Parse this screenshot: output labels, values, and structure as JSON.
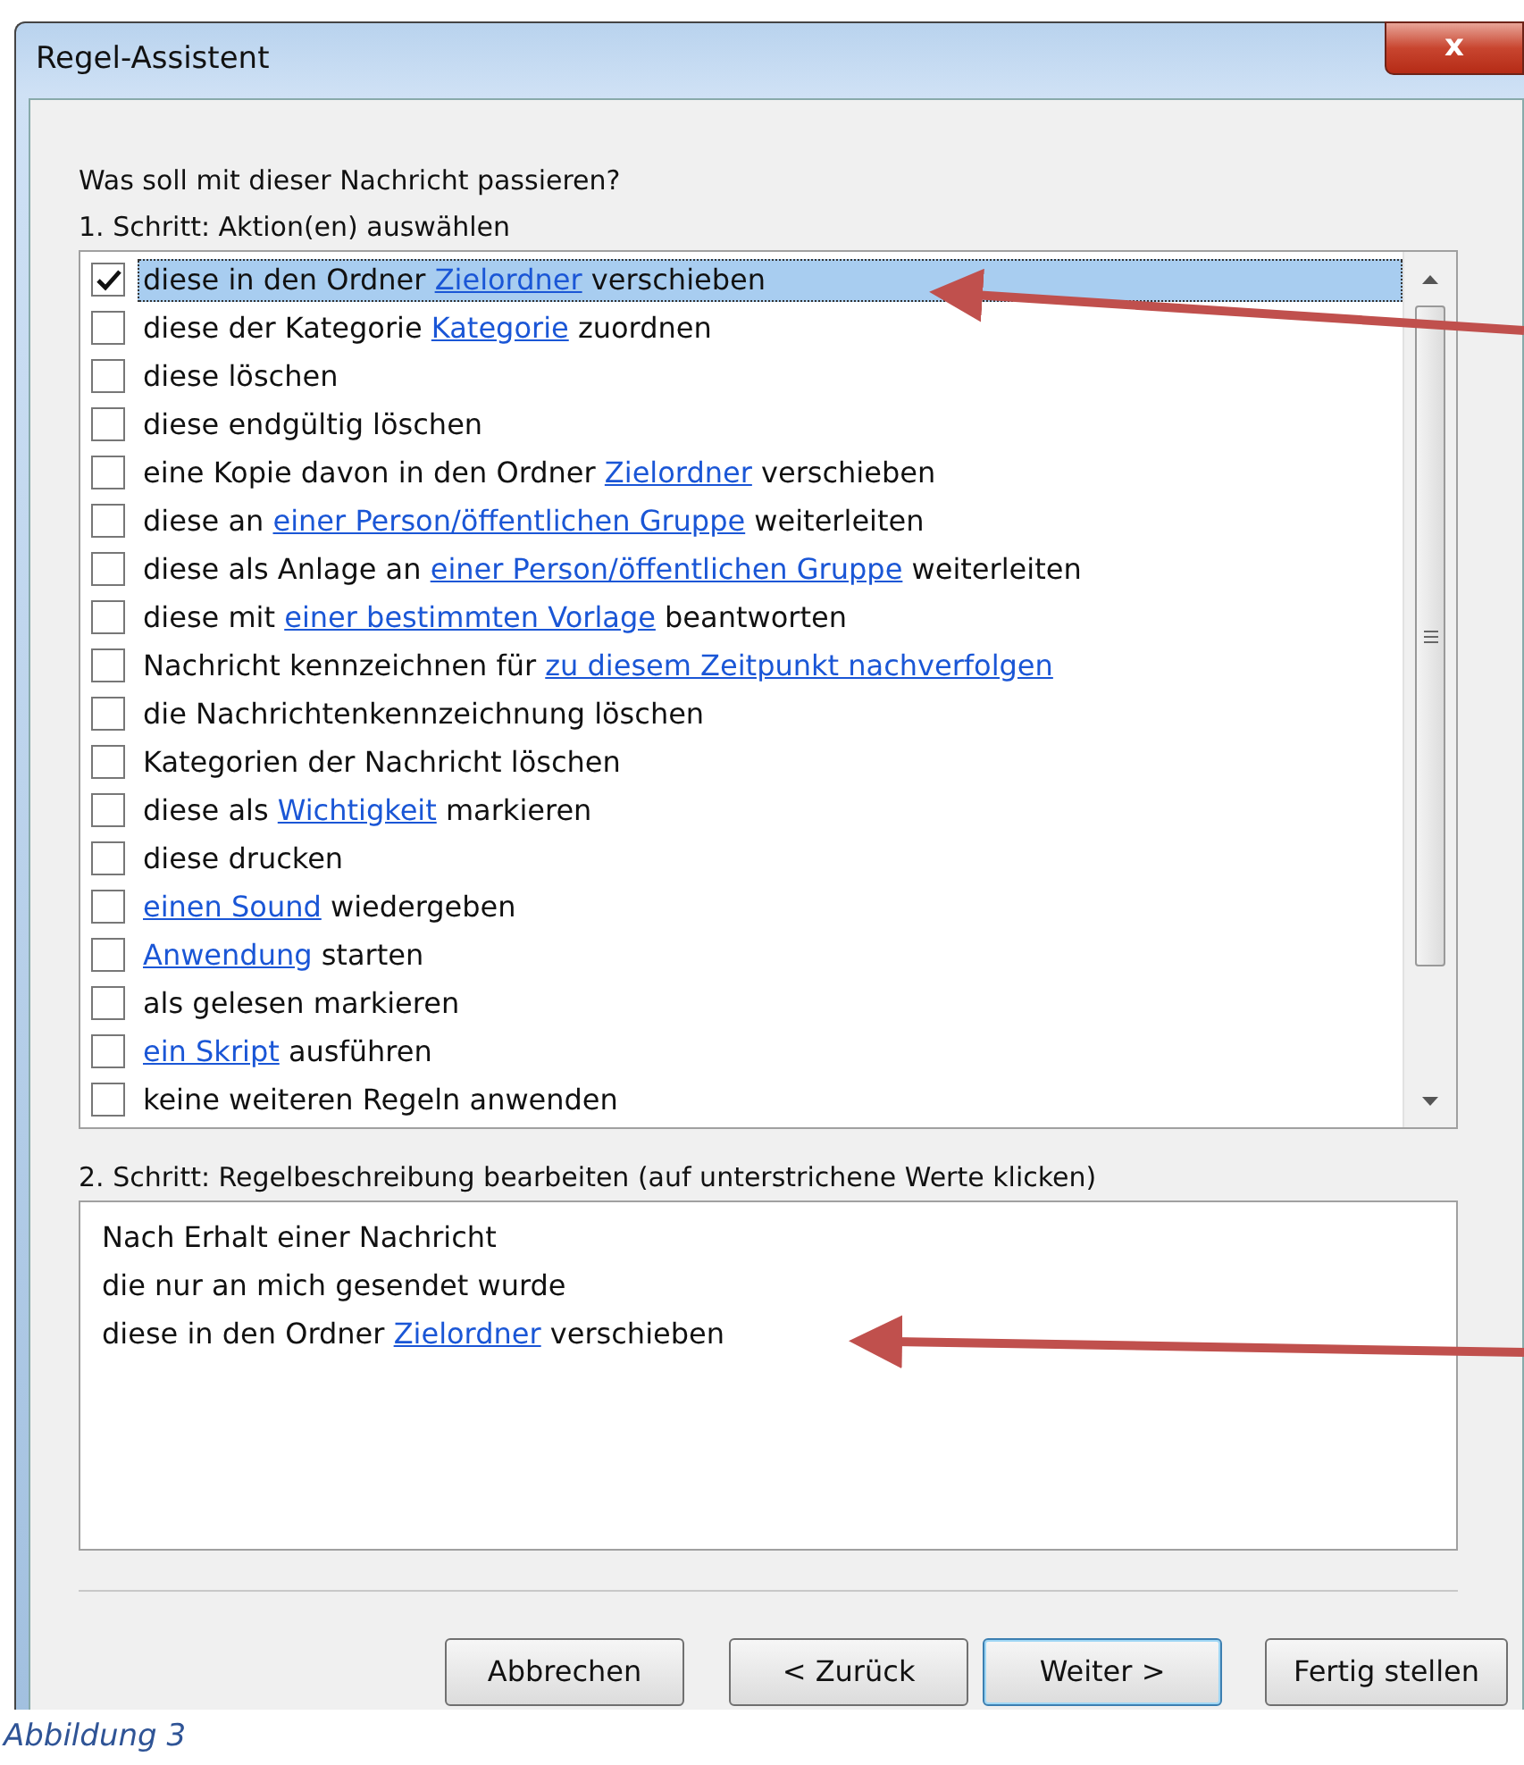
{
  "window": {
    "title": "Regel-Assistent",
    "close": "x"
  },
  "question": "Was soll mit dieser Nachricht passieren?",
  "step1": {
    "label": "1. Schritt: Aktion(en) auswählen",
    "actions": [
      {
        "checked": true,
        "selected": true,
        "parts": [
          {
            "kind": "text",
            "text": "diese in den Ordner "
          },
          {
            "kind": "link",
            "text": "Zielordner"
          },
          {
            "kind": "text",
            "text": " verschieben"
          }
        ]
      },
      {
        "checked": false,
        "selected": false,
        "parts": [
          {
            "kind": "text",
            "text": "diese der Kategorie "
          },
          {
            "kind": "link",
            "text": "Kategorie"
          },
          {
            "kind": "text",
            "text": " zuordnen"
          }
        ]
      },
      {
        "checked": false,
        "selected": false,
        "parts": [
          {
            "kind": "text",
            "text": "diese löschen"
          }
        ]
      },
      {
        "checked": false,
        "selected": false,
        "parts": [
          {
            "kind": "text",
            "text": "diese endgültig löschen"
          }
        ]
      },
      {
        "checked": false,
        "selected": false,
        "parts": [
          {
            "kind": "text",
            "text": "eine Kopie davon in den Ordner "
          },
          {
            "kind": "link",
            "text": "Zielordner"
          },
          {
            "kind": "text",
            "text": " verschieben"
          }
        ]
      },
      {
        "checked": false,
        "selected": false,
        "parts": [
          {
            "kind": "text",
            "text": "diese an "
          },
          {
            "kind": "link",
            "text": "einer Person/öffentlichen Gruppe"
          },
          {
            "kind": "text",
            "text": " weiterleiten"
          }
        ]
      },
      {
        "checked": false,
        "selected": false,
        "parts": [
          {
            "kind": "text",
            "text": "diese als Anlage an "
          },
          {
            "kind": "link",
            "text": "einer Person/öffentlichen Gruppe"
          },
          {
            "kind": "text",
            "text": " weiterleiten"
          }
        ]
      },
      {
        "checked": false,
        "selected": false,
        "parts": [
          {
            "kind": "text",
            "text": "diese mit "
          },
          {
            "kind": "link",
            "text": "einer bestimmten Vorlage"
          },
          {
            "kind": "text",
            "text": " beantworten"
          }
        ]
      },
      {
        "checked": false,
        "selected": false,
        "parts": [
          {
            "kind": "text",
            "text": "Nachricht kennzeichnen für "
          },
          {
            "kind": "link",
            "text": "zu diesem Zeitpunkt nachverfolgen"
          }
        ]
      },
      {
        "checked": false,
        "selected": false,
        "parts": [
          {
            "kind": "text",
            "text": "die Nachrichtenkennzeichnung löschen"
          }
        ]
      },
      {
        "checked": false,
        "selected": false,
        "parts": [
          {
            "kind": "text",
            "text": "Kategorien der Nachricht löschen"
          }
        ]
      },
      {
        "checked": false,
        "selected": false,
        "parts": [
          {
            "kind": "text",
            "text": "diese als "
          },
          {
            "kind": "link",
            "text": "Wichtigkeit"
          },
          {
            "kind": "text",
            "text": " markieren"
          }
        ]
      },
      {
        "checked": false,
        "selected": false,
        "parts": [
          {
            "kind": "text",
            "text": "diese drucken"
          }
        ]
      },
      {
        "checked": false,
        "selected": false,
        "parts": [
          {
            "kind": "link",
            "text": "einen Sound"
          },
          {
            "kind": "text",
            "text": " wiedergeben"
          }
        ]
      },
      {
        "checked": false,
        "selected": false,
        "parts": [
          {
            "kind": "link",
            "text": "Anwendung"
          },
          {
            "kind": "text",
            "text": " starten"
          }
        ]
      },
      {
        "checked": false,
        "selected": false,
        "parts": [
          {
            "kind": "text",
            "text": "als gelesen markieren"
          }
        ]
      },
      {
        "checked": false,
        "selected": false,
        "parts": [
          {
            "kind": "link",
            "text": "ein Skript"
          },
          {
            "kind": "text",
            "text": " ausführen"
          }
        ]
      },
      {
        "checked": false,
        "selected": false,
        "parts": [
          {
            "kind": "text",
            "text": "keine weiteren Regeln anwenden"
          }
        ]
      }
    ]
  },
  "step2": {
    "label": "2. Schritt: Regelbeschreibung bearbeiten (auf unterstrichene Werte klicken)",
    "lines": [
      [
        {
          "kind": "text",
          "text": "Nach Erhalt einer Nachricht"
        }
      ],
      [
        {
          "kind": "text",
          "text": "die nur an mich gesendet wurde"
        }
      ],
      [
        {
          "kind": "text",
          "text": "diese in den Ordner "
        },
        {
          "kind": "link",
          "text": "Zielordner"
        },
        {
          "kind": "text",
          "text": " verschieben"
        }
      ]
    ]
  },
  "buttons": [
    {
      "label": "Abbrechen",
      "focused": false
    },
    {
      "label": "< Zurück",
      "focused": false
    },
    {
      "label": "Weiter >",
      "focused": true
    },
    {
      "label": "Fertig stellen",
      "focused": false
    }
  ],
  "caption": "Abbildung 3"
}
